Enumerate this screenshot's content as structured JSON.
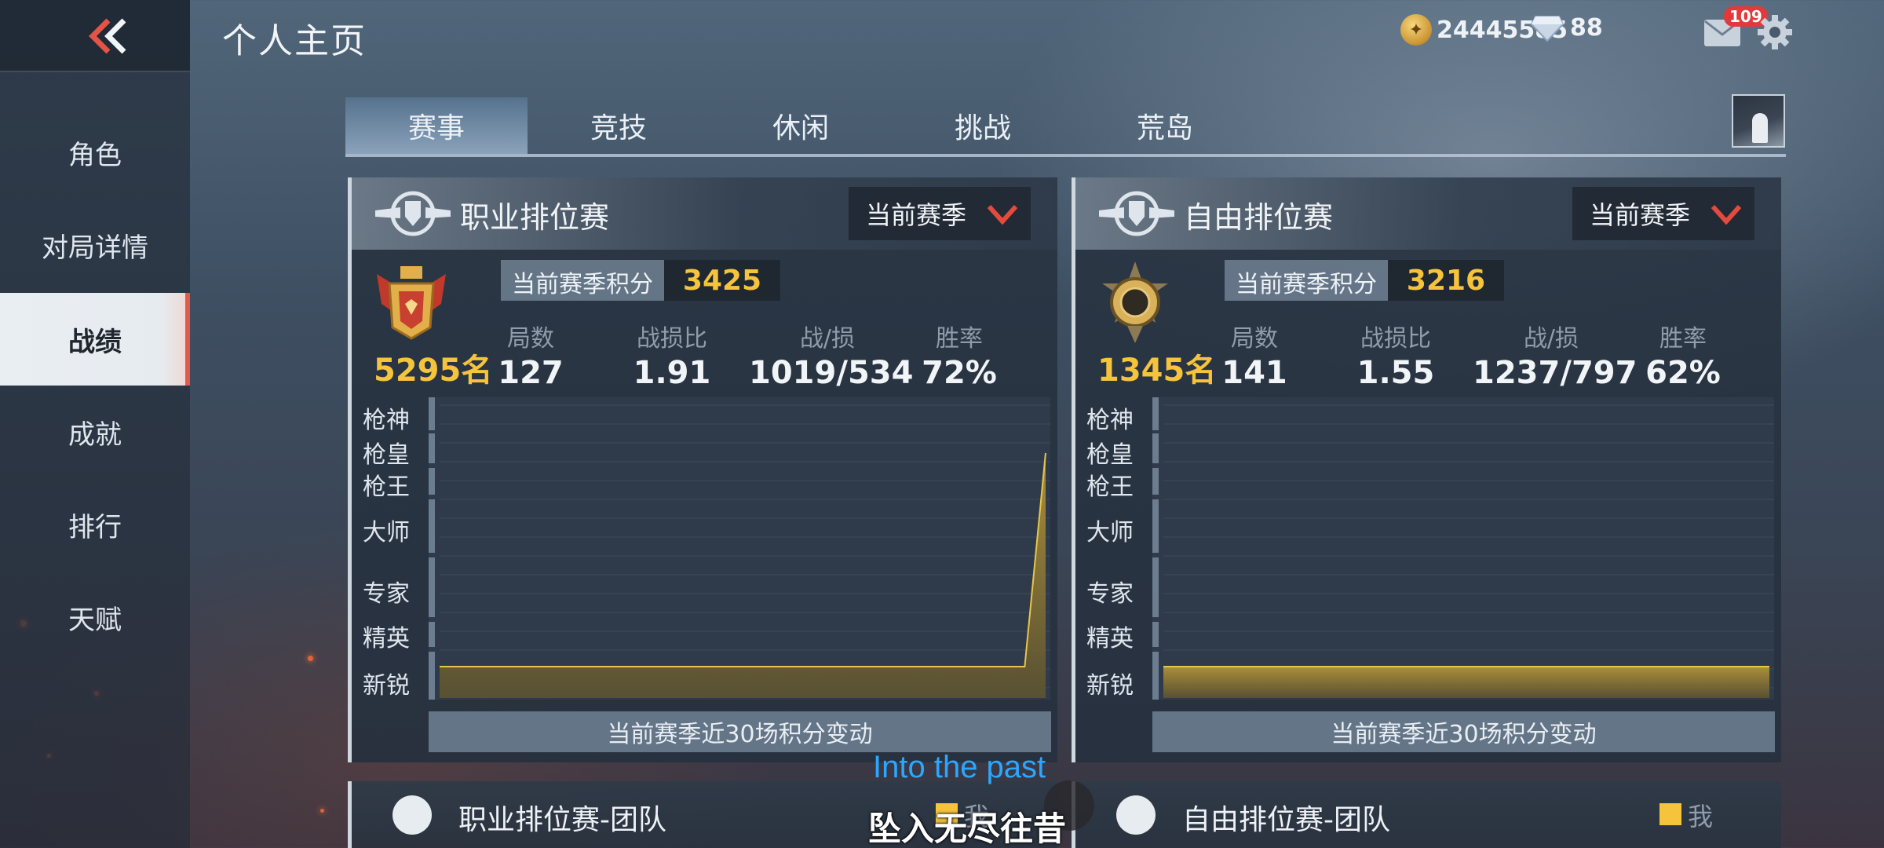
{
  "header": {
    "title": "个人主页",
    "gold": "24445585",
    "diamonds": "88",
    "mail_badge": "109",
    "icons": [
      "back-chevron-icon",
      "coin-icon",
      "diamond-icon",
      "mail-icon",
      "gear-icon"
    ]
  },
  "sidebar": {
    "items": [
      {
        "label": "角色"
      },
      {
        "label": "对局详情"
      },
      {
        "label": "战绩",
        "active": true
      },
      {
        "label": "成就"
      },
      {
        "label": "排行"
      },
      {
        "label": "天赋"
      }
    ]
  },
  "tabs": [
    {
      "label": "赛事",
      "active": true
    },
    {
      "label": "竞技"
    },
    {
      "label": "休闲"
    },
    {
      "label": "挑战"
    },
    {
      "label": "荒岛"
    }
  ],
  "panels": [
    {
      "title": "职业排位赛",
      "season_label": "当前赛季",
      "score_label": "当前赛季积分",
      "score": "3425",
      "rank": "5295名",
      "stats": [
        {
          "label": "局数",
          "value": "127"
        },
        {
          "label": "战损比",
          "value": "1.91"
        },
        {
          "label": "战/损",
          "value": "1019/534"
        },
        {
          "label": "胜率",
          "value": "72%"
        }
      ],
      "chart_footer": "当前赛季近30场积分变动"
    },
    {
      "title": "自由排位赛",
      "season_label": "当前赛季",
      "score_label": "当前赛季积分",
      "score": "3216",
      "rank": "1345名",
      "stats": [
        {
          "label": "局数",
          "value": "141"
        },
        {
          "label": "战损比",
          "value": "1.55"
        },
        {
          "label": "战/损",
          "value": "1237/797"
        },
        {
          "label": "胜率",
          "value": "62%"
        }
      ],
      "chart_footer": "当前赛季近30场积分变动"
    }
  ],
  "chart_data": [
    {
      "type": "area",
      "title": "当前赛季近30场积分变动",
      "y_tiers": [
        "枪神",
        "枪皇",
        "枪王",
        "大师",
        "专家",
        "精英",
        "新锐"
      ],
      "series": [
        {
          "values": [
            0.1,
            0.1,
            0.1,
            0.1,
            0.1,
            0.1,
            0.1,
            0.1,
            0.1,
            0.1,
            0.1,
            0.1,
            0.1,
            0.1,
            0.1,
            0.1,
            0.1,
            0.1,
            0.1,
            0.1,
            0.1,
            0.1,
            0.1,
            0.1,
            0.1,
            0.1,
            0.1,
            0.1,
            0.1,
            0.95
          ]
        }
      ],
      "ylim": [
        0,
        1
      ],
      "color": "#c9a83a"
    },
    {
      "type": "area",
      "title": "当前赛季近30场积分变动",
      "y_tiers": [
        "枪神",
        "枪皇",
        "枪王",
        "大师",
        "专家",
        "精英",
        "新锐"
      ],
      "series": [
        {
          "values": [
            0.1,
            0.1,
            0.1,
            0.1,
            0.1,
            0.1,
            0.1,
            0.1,
            0.1,
            0.1,
            0.1,
            0.1,
            0.1,
            0.1,
            0.1,
            0.1,
            0.1,
            0.1,
            0.1,
            0.1,
            0.1,
            0.1,
            0.1,
            0.1,
            0.1,
            0.1,
            0.1,
            0.1,
            0.1,
            0.1
          ]
        }
      ],
      "ylim": [
        0,
        1
      ],
      "color": "#c9a83a"
    }
  ],
  "teams": [
    {
      "title": "职业排位赛-团队",
      "legend": "我"
    },
    {
      "title": "自由排位赛-团队",
      "legend": "我"
    }
  ],
  "subtitles": {
    "en": "Into the past",
    "zh": "坠入无尽往昔"
  },
  "colors": {
    "accent_gold": "#f5c33c",
    "active_tab_red": "#e25a4a",
    "subtitle_blue": "#2aa7ff"
  }
}
